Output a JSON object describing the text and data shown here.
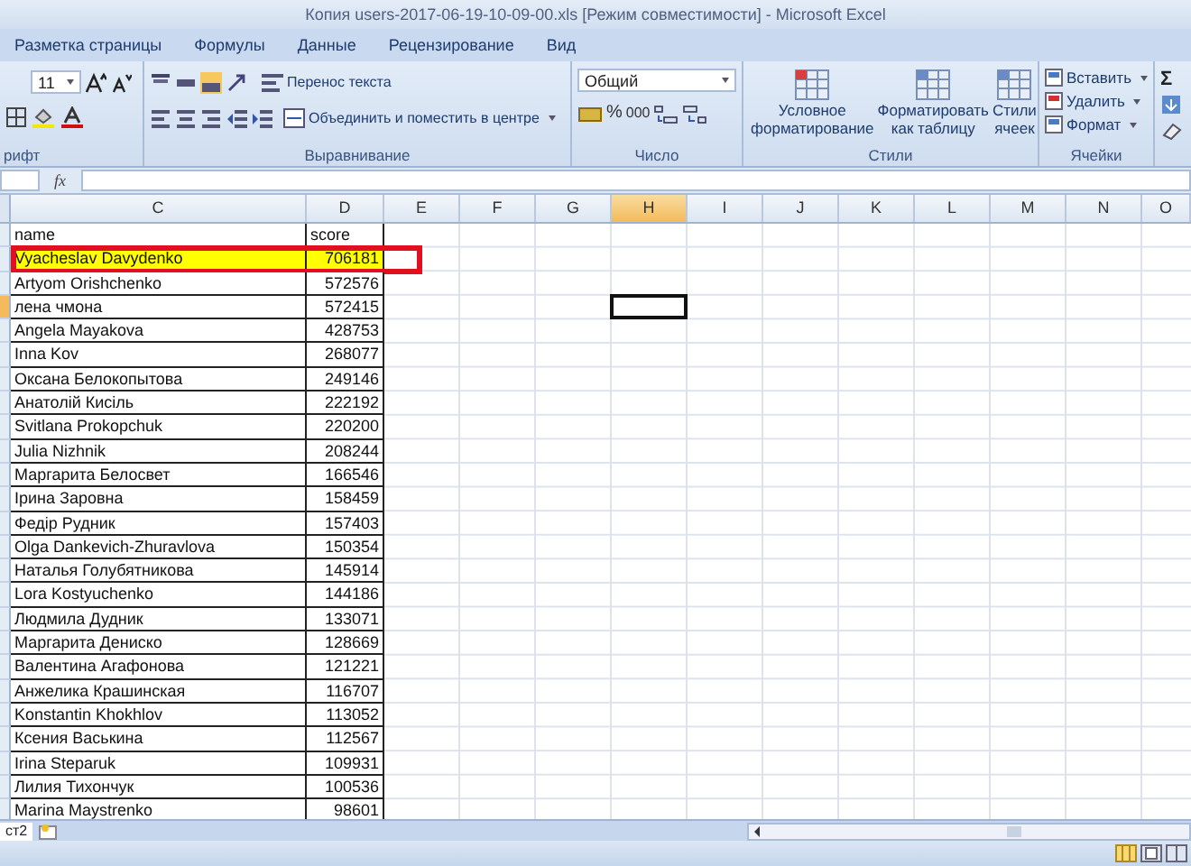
{
  "window": {
    "title": "Копия users-2017-06-19-10-09-00.xls  [Режим совместимости] - Microsoft Excel"
  },
  "ribbon_tabs": [
    "Разметка страницы",
    "Формулы",
    "Данные",
    "Рецензирование",
    "Вид"
  ],
  "ribbon": {
    "font": {
      "size": "11",
      "label": "рифт"
    },
    "alignment": {
      "wrap": "Перенос текста",
      "merge": "Объединить и поместить в центре",
      "label": "Выравнивание"
    },
    "number": {
      "format": "Общий",
      "percent": "%",
      "thousands": "000",
      "label": "Число"
    },
    "styles": {
      "buttons": [
        [
          "Условное",
          "форматирование"
        ],
        [
          "Форматировать",
          "как таблицу"
        ],
        [
          "Стили",
          "ячеек"
        ]
      ],
      "label": "Стили"
    },
    "cells": {
      "buttons": [
        "Вставить",
        "Удалить",
        "Формат"
      ],
      "label": "Ячейки"
    },
    "editing": {
      "sum": "Σ"
    }
  },
  "formula_bar": {
    "fx": "fx"
  },
  "columns": [
    {
      "label": "C",
      "selected": false
    },
    {
      "label": "D",
      "selected": false
    },
    {
      "label": "E",
      "selected": false
    },
    {
      "label": "F",
      "selected": false
    },
    {
      "label": "G",
      "selected": false
    },
    {
      "label": "H",
      "selected": true
    },
    {
      "label": "I",
      "selected": false
    },
    {
      "label": "J",
      "selected": false
    },
    {
      "label": "K",
      "selected": false
    },
    {
      "label": "L",
      "selected": false
    },
    {
      "label": "M",
      "selected": false
    },
    {
      "label": "N",
      "selected": false
    },
    {
      "label": "O",
      "selected": false
    }
  ],
  "sheet_rows": [
    {
      "name": "name",
      "score": "score",
      "kind": "header",
      "highlighted": false,
      "selected": false
    },
    {
      "name": "Vyacheslav Davydenko",
      "score": "706181",
      "kind": "data",
      "highlighted": true,
      "selected": false
    },
    {
      "name": "Artyom  Orishchenko",
      "score": "572576",
      "kind": "data",
      "highlighted": false,
      "selected": false
    },
    {
      "name": "лена чмона",
      "score": "572415",
      "kind": "data",
      "highlighted": false,
      "selected": true
    },
    {
      "name": "Angela  Mayakova",
      "score": "428753",
      "kind": "data",
      "highlighted": false,
      "selected": false
    },
    {
      "name": "Inna Kov",
      "score": "268077",
      "kind": "data",
      "highlighted": false,
      "selected": false
    },
    {
      "name": "Оксана Белокопытова",
      "score": "249146",
      "kind": "data",
      "highlighted": false,
      "selected": false
    },
    {
      "name": "Анатолій Кисіль",
      "score": "222192",
      "kind": "data",
      "highlighted": false,
      "selected": false
    },
    {
      "name": "Svitlana  Prokopchuk",
      "score": "220200",
      "kind": "data",
      "highlighted": false,
      "selected": false
    },
    {
      "name": "Julia  Nizhnik",
      "score": "208244",
      "kind": "data",
      "highlighted": false,
      "selected": false
    },
    {
      "name": "Маргарита Белосвет",
      "score": "166546",
      "kind": "data",
      "highlighted": false,
      "selected": false
    },
    {
      "name": "Ірина Заровна",
      "score": "158459",
      "kind": "data",
      "highlighted": false,
      "selected": false
    },
    {
      "name": "Федір Рудник",
      "score": "157403",
      "kind": "data",
      "highlighted": false,
      "selected": false
    },
    {
      "name": "Olga Dankevich-Zhuravlova",
      "score": "150354",
      "kind": "data",
      "highlighted": false,
      "selected": false
    },
    {
      "name": "Наталья Голубятникова",
      "score": "145914",
      "kind": "data",
      "highlighted": false,
      "selected": false
    },
    {
      "name": "Lora Kostyuchenko",
      "score": "144186",
      "kind": "data",
      "highlighted": false,
      "selected": false
    },
    {
      "name": "Людмила Дудник",
      "score": "133071",
      "kind": "data",
      "highlighted": false,
      "selected": false
    },
    {
      "name": "Маргарита Дениско",
      "score": "128669",
      "kind": "data",
      "highlighted": false,
      "selected": false
    },
    {
      "name": "Валентина Агафонова",
      "score": "121221",
      "kind": "data",
      "highlighted": false,
      "selected": false
    },
    {
      "name": "Анжелика Крашинская",
      "score": "116707",
      "kind": "data",
      "highlighted": false,
      "selected": false
    },
    {
      "name": "Konstantin  Khokhlov",
      "score": "113052",
      "kind": "data",
      "highlighted": false,
      "selected": false
    },
    {
      "name": "Ксения Васькина",
      "score": "112567",
      "kind": "data",
      "highlighted": false,
      "selected": false
    },
    {
      "name": "Irina  Steparuk",
      "score": "109931",
      "kind": "data",
      "highlighted": false,
      "selected": false
    },
    {
      "name": "Лилия Тихончук",
      "score": "100536",
      "kind": "data",
      "highlighted": false,
      "selected": false
    },
    {
      "name": "Marina Maystrenko",
      "score": "98601",
      "kind": "data",
      "highlighted": false,
      "selected": false
    }
  ],
  "sheet_tabs": [
    "ст2"
  ]
}
